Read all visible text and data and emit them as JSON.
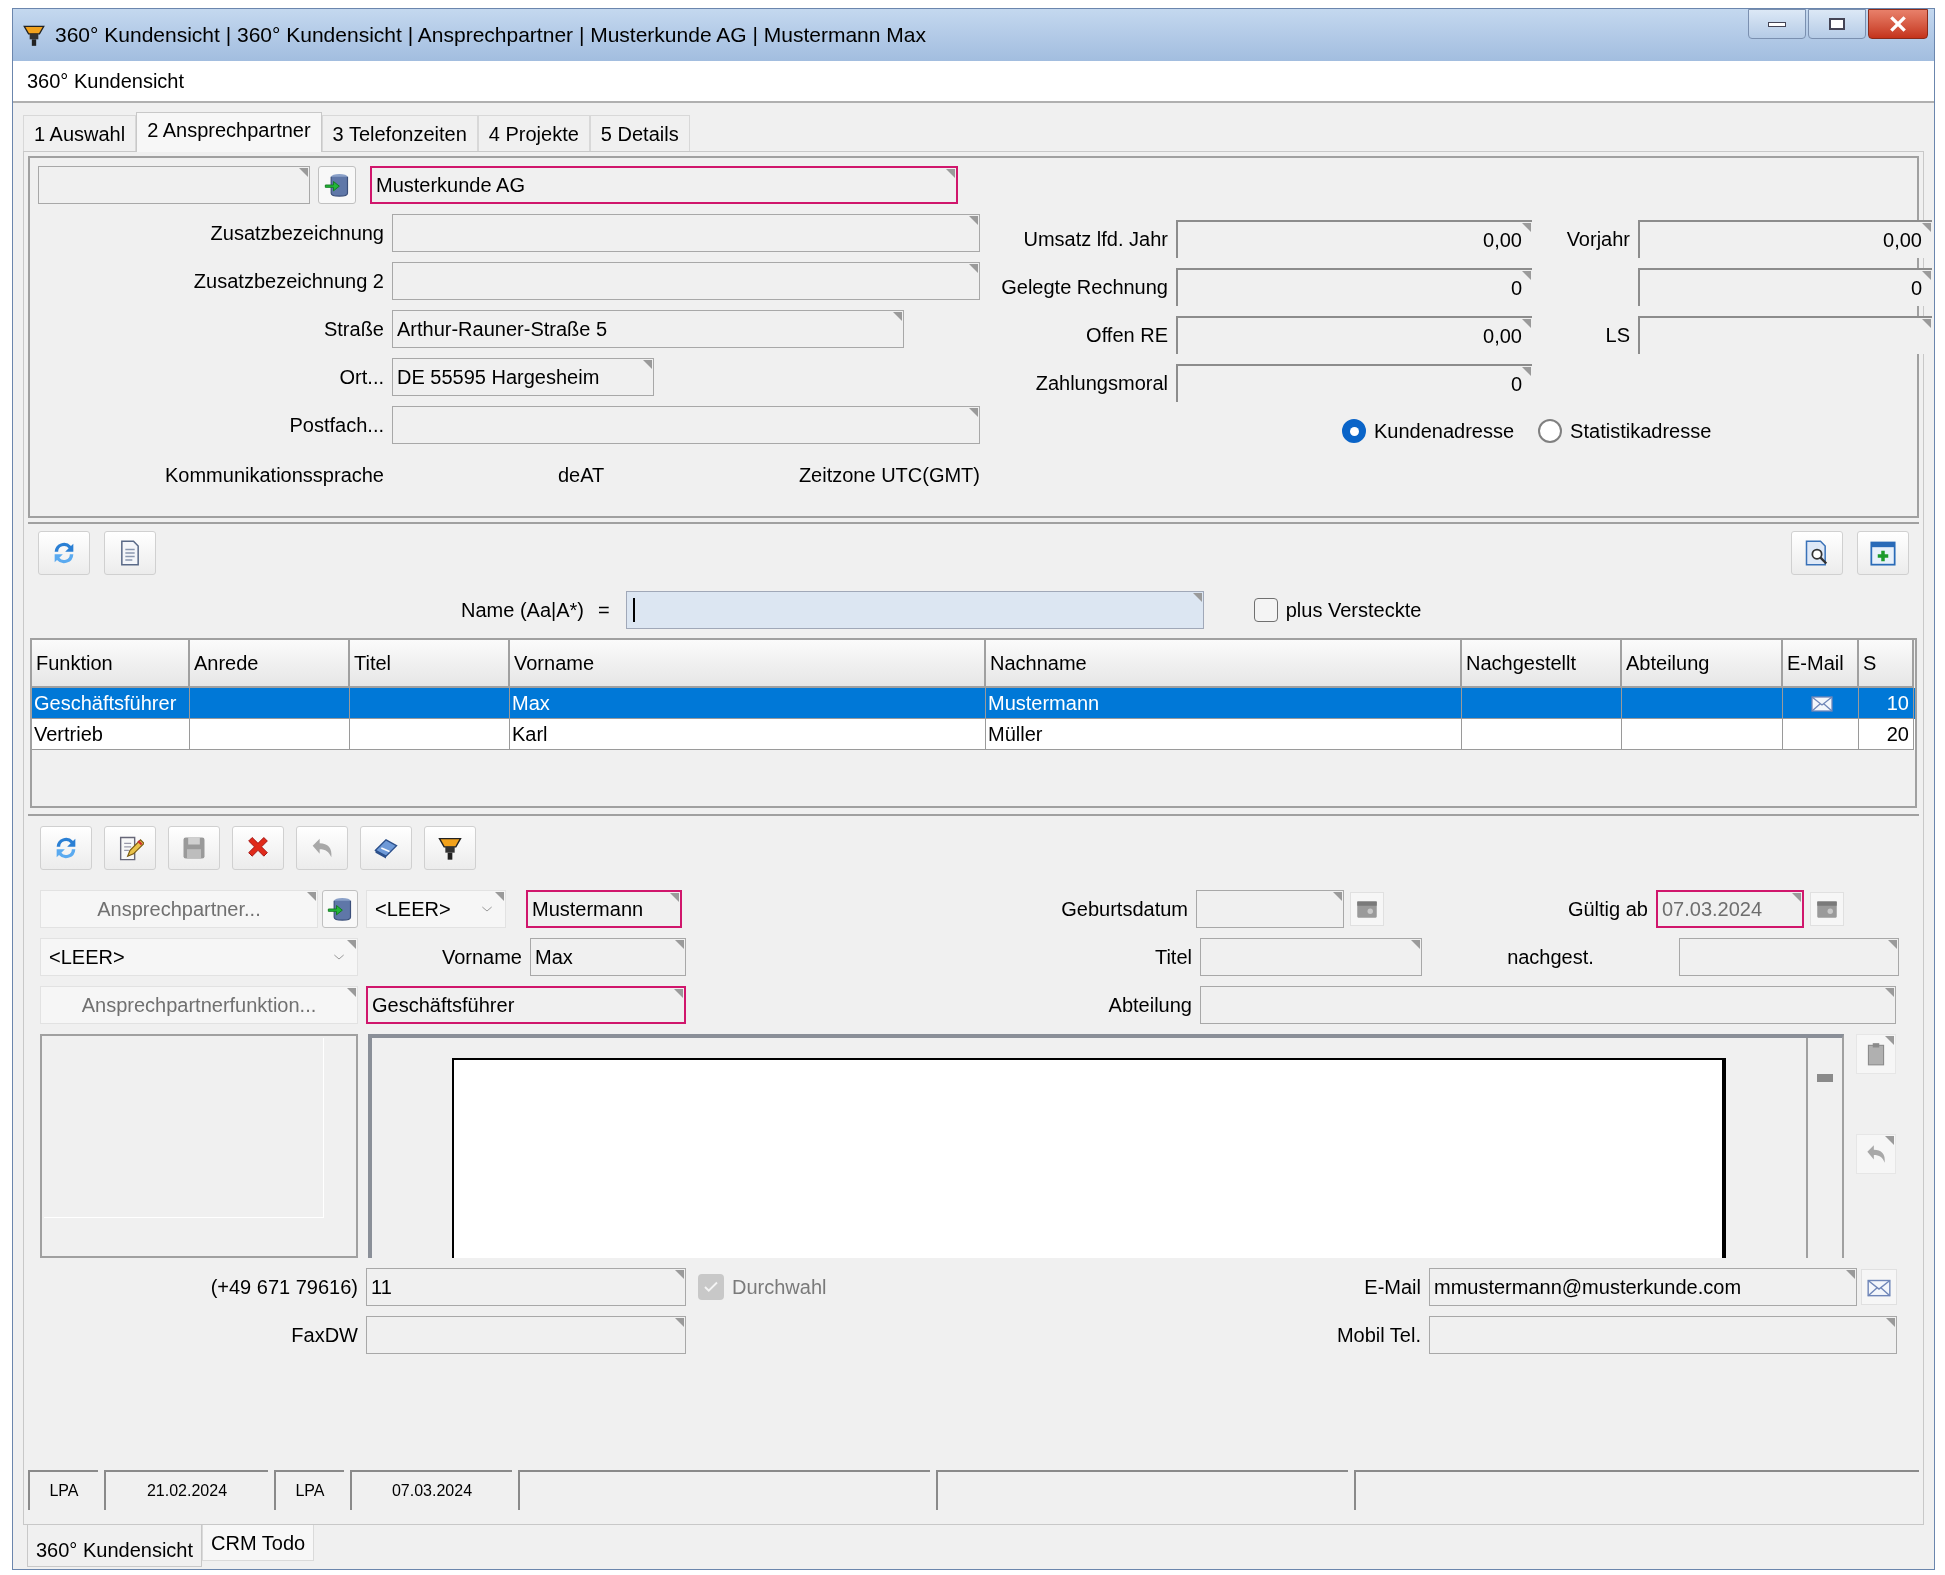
{
  "window": {
    "title": "360° Kundensicht | 360° Kundensicht | Ansprechpartner | Musterkunde AG | Mustermann Max"
  },
  "view_title": "360° Kundensicht",
  "tabs": [
    {
      "label": "1 Auswahl",
      "selected": false
    },
    {
      "label": "2 Ansprechpartner",
      "selected": true
    },
    {
      "label": "3 Telefonzeiten",
      "selected": false
    },
    {
      "label": "4 Projekte",
      "selected": false
    },
    {
      "label": "5 Details",
      "selected": false
    }
  ],
  "customer": {
    "name": {
      "value": "Musterkunde AG",
      "required": true
    },
    "address": [
      {
        "label": "Zusatzbezeichnung"
      },
      {
        "label": "Zusatzbezeichnung 2"
      },
      {
        "label": "Straße",
        "value": "Arthur-Rauner-Straße 5"
      },
      {
        "label": "Ort...",
        "value": "DE 55595 Hargesheim"
      },
      {
        "label": "Postfach..."
      }
    ],
    "language_label": "Kommunikationssprache",
    "language": "deAT",
    "timezone": "Zeitzone UTC(GMT)",
    "figures": [
      {
        "label": "Umsatz lfd. Jahr",
        "value": "0,00",
        "label_2": "Vorjahr",
        "value_2": "0,00"
      },
      {
        "label": "Gelegte Rechnung",
        "value": "0",
        "value_2": "0"
      },
      {
        "label": "Offen RE",
        "value": "0,00",
        "label_2": "LS"
      },
      {
        "label": "Zahlungsmoral",
        "value": "0"
      }
    ],
    "address_type": [
      {
        "label": "Kundenadresse",
        "selected": true
      },
      {
        "label": "Statistikadresse",
        "selected": false
      }
    ]
  },
  "filter": {
    "label": "Name (Aa|A*)",
    "operator": "=",
    "show_hidden": {
      "label": "plus Versteckte",
      "checked": false
    }
  },
  "table": {
    "columns": [
      "Funktion",
      "Anrede",
      "Titel",
      "Vorname",
      "Nachname",
      "Nachgestellt",
      "Abteilung",
      "E-Mail",
      "S"
    ],
    "rows": [
      {
        "selected": true,
        "function": "Geschäftsführer",
        "first_name": "Max",
        "last_name": "Mustermann",
        "has_email": true,
        "s": "10"
      },
      {
        "selected": false,
        "function": "Vertrieb",
        "first_name": "Karl",
        "last_name": "Müller",
        "has_email": false,
        "s": "20"
      }
    ]
  },
  "contact": {
    "picker": "Ansprechpartner...",
    "salutation": "<LEER>",
    "last_name": {
      "value": "Mustermann",
      "required": true
    },
    "title_select": "<LEER>",
    "first_name_label": "Vorname",
    "first_name": {
      "value": "Max",
      "required": false
    },
    "function_picker": "Ansprechpartnerfunktion...",
    "function": {
      "value": "Geschäftsführer",
      "required": true
    },
    "birthdate_label": "Geburtsdatum",
    "valid_from_label": "Gültig ab",
    "valid_from": {
      "value": "07.03.2024",
      "required": true,
      "disabled": true
    },
    "title_label": "Titel",
    "suffix_label": "nachgest.",
    "department_label": "Abteilung",
    "phone_prefix": "(+49 671 79616)",
    "extension": "11",
    "direct_dial": {
      "label": "Durchwahl",
      "checked": true,
      "disabled": true
    },
    "fax_label": "FaxDW",
    "email_label": "E-Mail",
    "email": "mmustermann@musterkunde.com",
    "mobile_label": "Mobil Tel."
  },
  "status_bar": [
    {
      "text": "LPA"
    },
    {
      "text": "21.02.2024"
    },
    {
      "text": "LPA"
    },
    {
      "text": "07.03.2024"
    }
  ],
  "bottom_tabs": [
    {
      "label": "360° Kundensicht",
      "selected": true
    },
    {
      "label": "CRM Todo",
      "selected": false
    }
  ]
}
